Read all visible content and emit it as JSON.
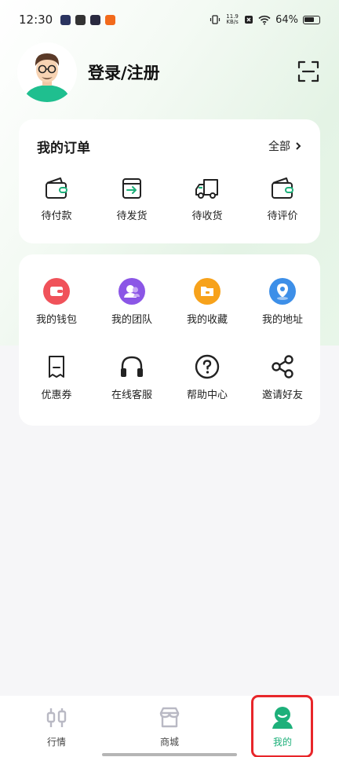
{
  "status": {
    "time": "12:30",
    "net_speed_value": "11.9",
    "net_speed_unit": "KB/s",
    "battery": "64%"
  },
  "profile": {
    "login_label": "登录/注册"
  },
  "orders": {
    "title": "我的订单",
    "more": "全部",
    "items": [
      {
        "label": "待付款",
        "icon": "wallet-icon"
      },
      {
        "label": "待发货",
        "icon": "box-arrow-icon"
      },
      {
        "label": "待收货",
        "icon": "truck-icon"
      },
      {
        "label": "待评价",
        "icon": "wallet-review-icon"
      }
    ]
  },
  "services": {
    "row1": [
      {
        "label": "我的钱包",
        "icon": "wallet-icon",
        "color": "#f0525a"
      },
      {
        "label": "我的团队",
        "icon": "team-icon",
        "color": "#8b56e6"
      },
      {
        "label": "我的收藏",
        "icon": "folder-icon",
        "color": "#f7a21b"
      },
      {
        "label": "我的地址",
        "icon": "location-icon",
        "color": "#3d8fe8"
      }
    ],
    "row2": [
      {
        "label": "优惠券",
        "icon": "coupon-icon"
      },
      {
        "label": "在线客服",
        "icon": "headset-icon"
      },
      {
        "label": "帮助中心",
        "icon": "help-icon"
      },
      {
        "label": "邀请好友",
        "icon": "share-icon"
      }
    ]
  },
  "tabbar": {
    "items": [
      {
        "label": "行情",
        "icon": "market-icon"
      },
      {
        "label": "商城",
        "icon": "shop-icon"
      },
      {
        "label": "我的",
        "icon": "profile-icon"
      }
    ],
    "active_index": 2,
    "accent": "#1db07a"
  }
}
